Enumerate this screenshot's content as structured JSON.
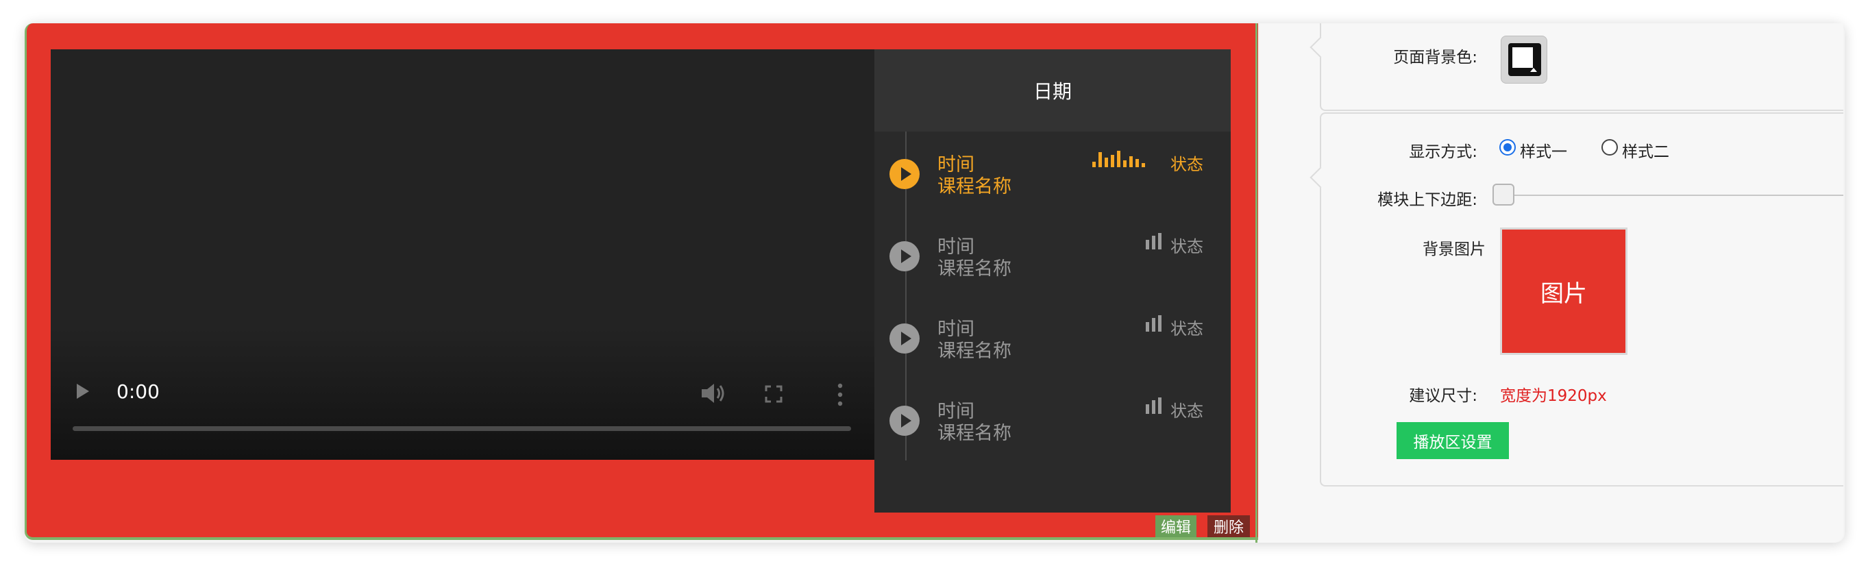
{
  "player": {
    "current_time": "0:00"
  },
  "playlist": {
    "header": "日期",
    "items": [
      {
        "time": "时间",
        "name": "课程名称",
        "status": "状态",
        "active": true
      },
      {
        "time": "时间",
        "name": "课程名称",
        "status": "状态",
        "active": false
      },
      {
        "time": "时间",
        "name": "课程名称",
        "status": "状态",
        "active": false
      },
      {
        "time": "时间",
        "name": "课程名称",
        "status": "状态",
        "active": false
      }
    ]
  },
  "module_actions": {
    "edit_label": "编辑",
    "delete_label": "删除"
  },
  "settings": {
    "page_bg_label": "页面背景色:",
    "display_mode_label": "显示方式:",
    "display_options": [
      "样式一",
      "样式二"
    ],
    "display_selected": "样式一",
    "margin_label": "模块上下边距:",
    "margin_value": 0,
    "bg_image_label": "背景图片",
    "bg_image_placeholder": "图片",
    "size_label": "建议尺寸:",
    "size_hint": "宽度为1920px",
    "player_settings_button": "播放区设置"
  },
  "colors": {
    "module_bg": "#e4352b",
    "active_accent": "#f5a623",
    "primary_button": "#22c55e",
    "edit_button": "#6aa15a",
    "delete_button": "#7a2a22",
    "hint_text": "#e02020",
    "radio_checked": "#1a6fe8"
  }
}
